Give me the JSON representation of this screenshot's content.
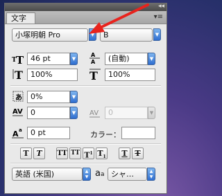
{
  "panel": {
    "tab_label": "文字",
    "collapse_glyph": "◂◂",
    "menu_glyph": "▾≡"
  },
  "font": {
    "family": "小塚明朝 Pro",
    "style": "B"
  },
  "metrics": {
    "size": "46 pt",
    "leading": "(自動)",
    "vertical_scale": "100%",
    "horizontal_scale": "100%",
    "tsume": "0%",
    "kerning": "0",
    "tracking": "0",
    "baseline_shift": "0 pt",
    "color_label": "カラー：",
    "color_value": ""
  },
  "style_buttons": {
    "faux_bold": "T",
    "faux_italic": "T",
    "all_caps": "TT",
    "small_caps": "TT",
    "superscript_base": "T",
    "superscript_mark": "1",
    "subscript_base": "T",
    "subscript_mark": "1",
    "underline": "T",
    "strikethrough": "T"
  },
  "bottom": {
    "language": "英語 (米国)",
    "aa_label": "a",
    "aa_small": "a",
    "antialias": "シャ…"
  },
  "colors": {
    "accent_blue": "#3a7bd5",
    "arrow_red": "#e8231d",
    "panel_bg": "#e9e9e9"
  }
}
